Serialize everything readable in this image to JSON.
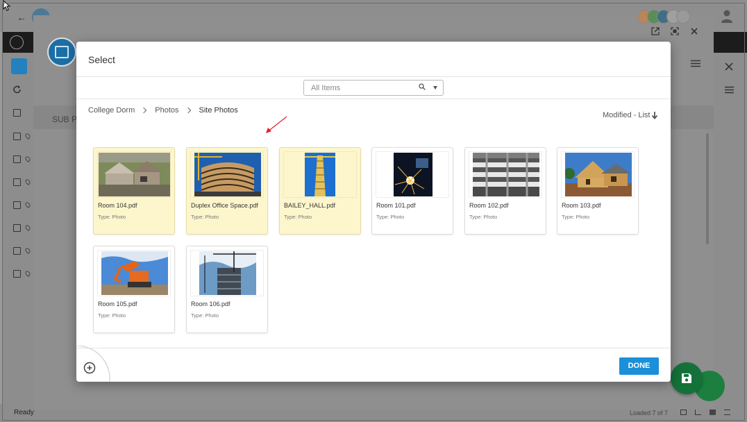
{
  "background_app": {
    "sub_panel_label": "SUB P",
    "status_left": "Ready",
    "status_right": "Loaded 7 of 7"
  },
  "modal": {
    "title": "Select",
    "search": {
      "placeholder": "All Items"
    },
    "breadcrumb": [
      "College Dorm",
      "Photos",
      "Site Photos"
    ],
    "sort_label": "Modified - List",
    "done_label": "DONE",
    "items": [
      {
        "name": "Room 104.pdf",
        "type": "Type: Photo",
        "selected": true,
        "thumb": "house-demolition"
      },
      {
        "name": "Duplex Office Space.pdf",
        "type": "Type: Photo",
        "selected": true,
        "thumb": "curved-building"
      },
      {
        "name": "BAILEY_HALL.pdf",
        "type": "Type: Photo",
        "selected": true,
        "thumb": "tower-crane"
      },
      {
        "name": "Room 101.pdf",
        "type": "Type: Photo",
        "selected": false,
        "thumb": "welding-sparks"
      },
      {
        "name": "Room 102.pdf",
        "type": "Type: Photo",
        "selected": false,
        "thumb": "concrete-floors"
      },
      {
        "name": "Room 103.pdf",
        "type": "Type: Photo",
        "selected": false,
        "thumb": "house-frame"
      },
      {
        "name": "Room 105.pdf",
        "type": "Type: Photo",
        "selected": false,
        "thumb": "excavator"
      },
      {
        "name": "Room 106.pdf",
        "type": "Type: Photo",
        "selected": false,
        "thumb": "site-cranes"
      }
    ]
  },
  "colors": {
    "selected_tile": "#fdf6cc",
    "done_button": "#1b8fd8",
    "fab": "#14713a",
    "annotation_arrow": "#e02020"
  }
}
